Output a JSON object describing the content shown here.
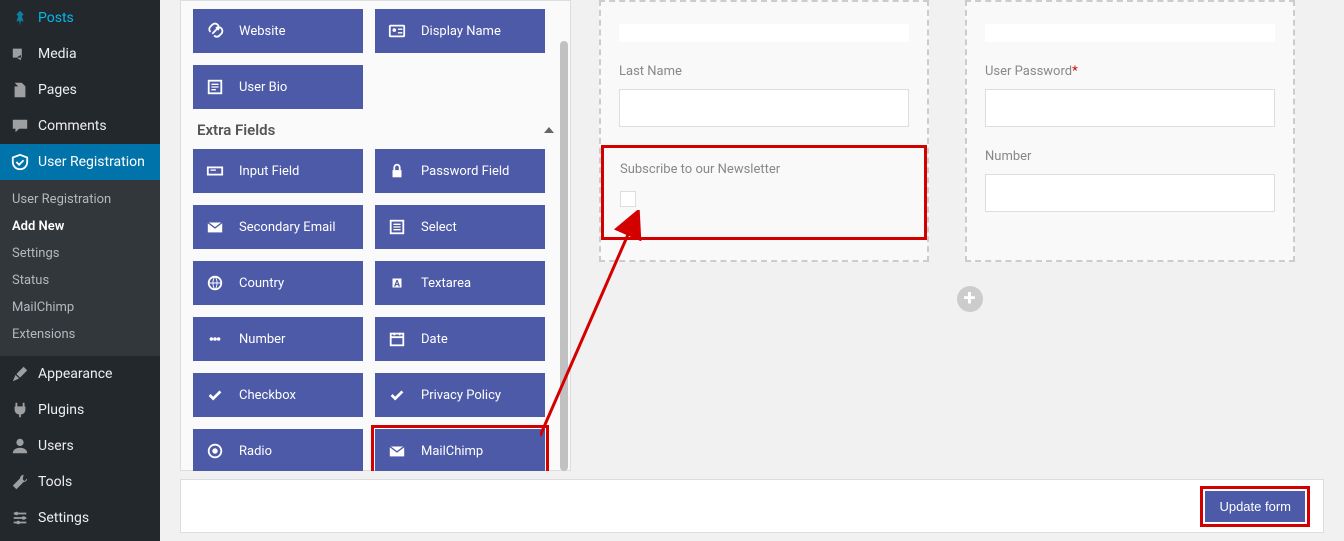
{
  "sidebar": {
    "items": [
      {
        "label": "Posts",
        "icon": "pin"
      },
      {
        "label": "Media",
        "icon": "media"
      },
      {
        "label": "Pages",
        "icon": "page"
      },
      {
        "label": "Comments",
        "icon": "comment"
      },
      {
        "label": "User Registration",
        "icon": "ur",
        "active": true
      }
    ],
    "submenu": [
      {
        "label": "User Registration"
      },
      {
        "label": "Add New",
        "current": true
      },
      {
        "label": "Settings"
      },
      {
        "label": "Status"
      },
      {
        "label": "MailChimp"
      },
      {
        "label": "Extensions"
      }
    ],
    "items2": [
      {
        "label": "Appearance",
        "icon": "brush"
      },
      {
        "label": "Plugins",
        "icon": "plug"
      },
      {
        "label": "Users",
        "icon": "user"
      },
      {
        "label": "Tools",
        "icon": "wrench"
      },
      {
        "label": "Settings",
        "icon": "sliders"
      }
    ]
  },
  "palette": {
    "default_fields": [
      {
        "label": "Website",
        "icon": "link"
      },
      {
        "label": "Display Name",
        "icon": "idcard"
      },
      {
        "label": "User Bio",
        "icon": "bio"
      }
    ],
    "extra_head": "Extra Fields",
    "extra_fields": [
      {
        "label": "Input Field",
        "icon": "input"
      },
      {
        "label": "Password Field",
        "icon": "lock"
      },
      {
        "label": "Secondary Email",
        "icon": "mail"
      },
      {
        "label": "Select",
        "icon": "select"
      },
      {
        "label": "Country",
        "icon": "globe"
      },
      {
        "label": "Textarea",
        "icon": "textarea"
      },
      {
        "label": "Number",
        "icon": "number"
      },
      {
        "label": "Date",
        "icon": "date"
      },
      {
        "label": "Checkbox",
        "icon": "check"
      },
      {
        "label": "Privacy Policy",
        "icon": "check"
      },
      {
        "label": "Radio",
        "icon": "radio"
      },
      {
        "label": "MailChimp",
        "icon": "mail",
        "highlight": true
      }
    ]
  },
  "form": {
    "col1": {
      "f0_label": "",
      "f1_label": "Last Name",
      "f2_label": "Subscribe to our Newsletter"
    },
    "col2": {
      "f0_label": "",
      "f1_label": "User Password",
      "f1_required": "*",
      "f2_label": "Number"
    }
  },
  "footer": {
    "update": "Update form"
  }
}
